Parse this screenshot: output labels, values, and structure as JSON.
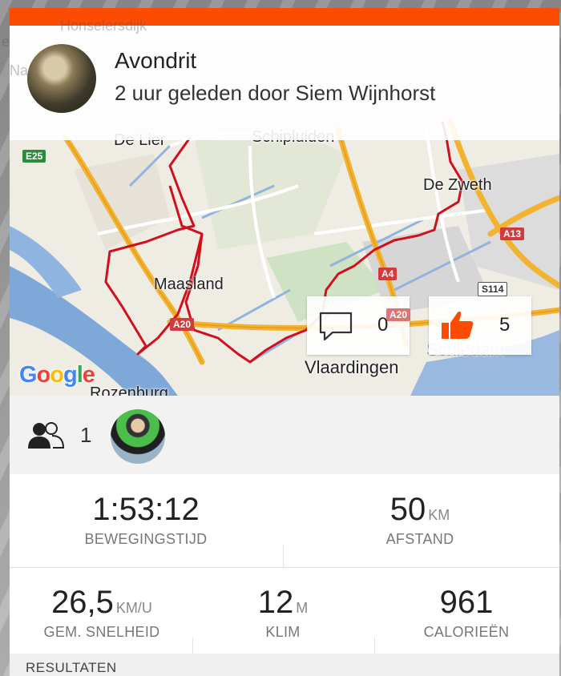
{
  "activity": {
    "title": "Avondrit",
    "subtitle": "2 uur geleden door Siem Wijnhorst"
  },
  "map": {
    "places": [
      "De Lier",
      "Schipluiden",
      "De Zweth",
      "Maasland",
      "Vlaardingen",
      "Schiedam",
      "Rozenburg",
      "Honselersdijk",
      "Na",
      "e"
    ],
    "road_labels": [
      "E25",
      "A4",
      "A13",
      "A20",
      "S114",
      "A20"
    ],
    "route_color": "#d0101c",
    "provider": "Google"
  },
  "social": {
    "comments_count": "0",
    "kudos_count": "5",
    "athletes_count": "1"
  },
  "stats": {
    "moving_time": {
      "value": "1:53:12",
      "unit": "",
      "label": "BEWEGINGSTIJD"
    },
    "distance": {
      "value": "50",
      "unit": "KM",
      "label": "AFSTAND"
    },
    "avg_speed": {
      "value": "26,5",
      "unit": "KM/U",
      "label": "GEM. SNELHEID"
    },
    "climb": {
      "value": "12",
      "unit": "M",
      "label": "KLIM"
    },
    "calories": {
      "value": "961",
      "unit": "",
      "label": "CALORIEËN"
    }
  },
  "sections": {
    "results_label": "RESULTATEN"
  },
  "colors": {
    "brand": "#fc4c02",
    "route": "#d0101c"
  }
}
